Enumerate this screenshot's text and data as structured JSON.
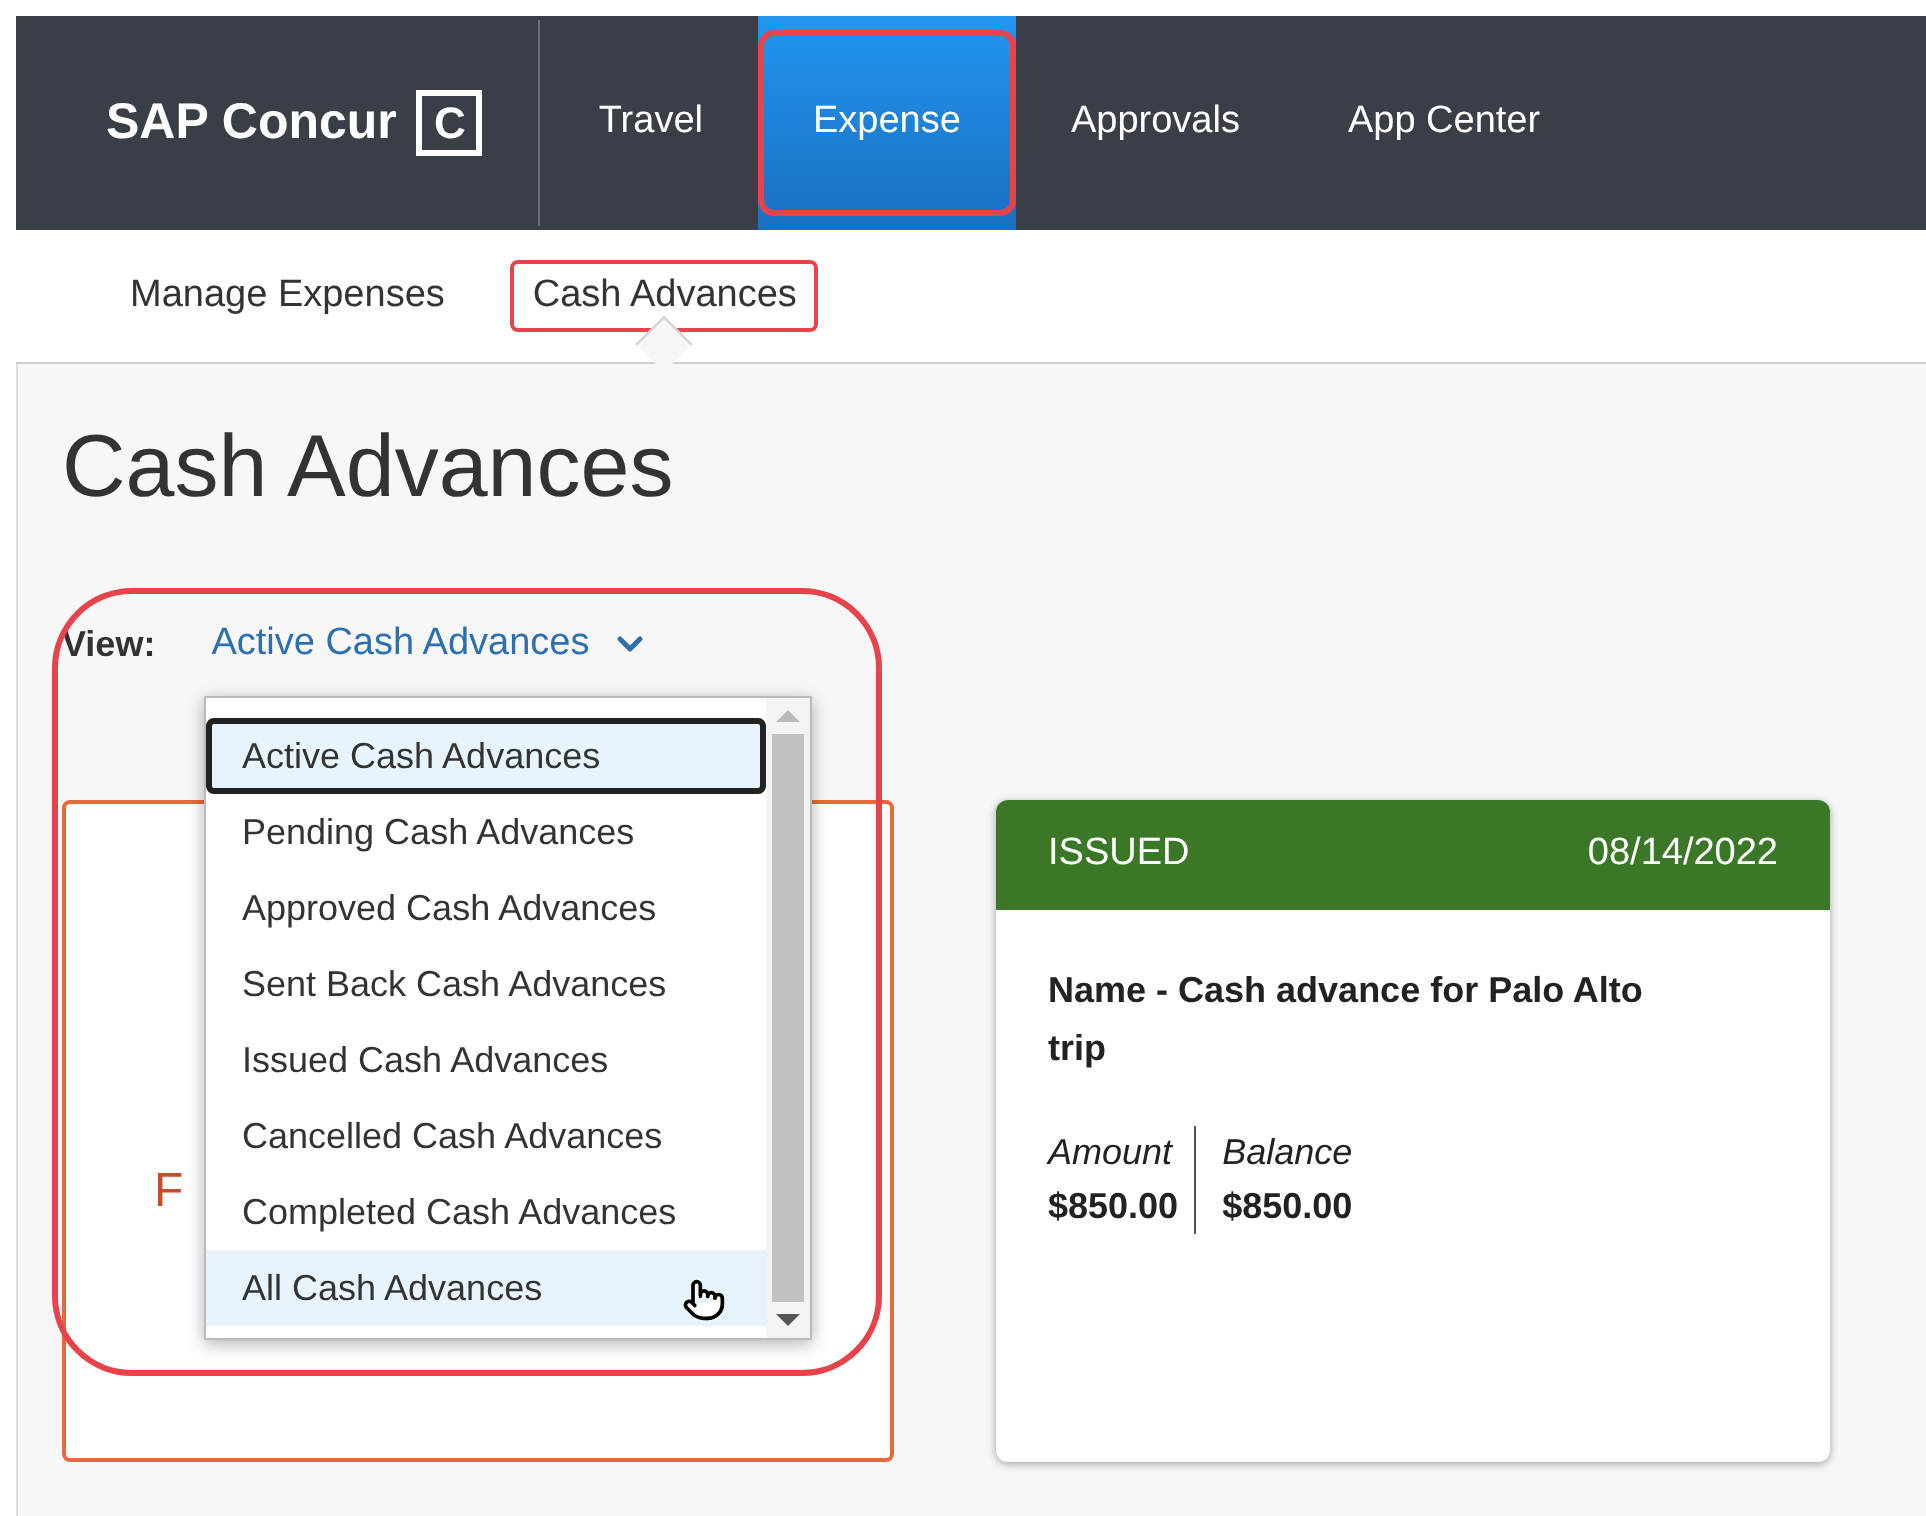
{
  "brand": {
    "name": "SAP Concur",
    "mark": "C"
  },
  "nav": [
    {
      "label": "Travel",
      "selected": false,
      "callout": false
    },
    {
      "label": "Expense",
      "selected": true,
      "callout": true
    },
    {
      "label": "Approvals",
      "selected": false,
      "callout": false
    },
    {
      "label": "App Center",
      "selected": false,
      "callout": false
    }
  ],
  "subnav": [
    {
      "label": "Manage Expenses",
      "selected": false,
      "callout": false
    },
    {
      "label": "Cash Advances",
      "selected": true,
      "callout": true
    }
  ],
  "page_title": "Cash Advances",
  "view": {
    "label": "View:",
    "value": "Active Cash Advances",
    "callout": true
  },
  "dropdown": {
    "options": [
      {
        "label": "Active Cash Advances",
        "selected": true,
        "hovered": false
      },
      {
        "label": "Pending Cash Advances",
        "selected": false,
        "hovered": false
      },
      {
        "label": "Approved Cash Advances",
        "selected": false,
        "hovered": false
      },
      {
        "label": "Sent Back Cash Advances",
        "selected": false,
        "hovered": false
      },
      {
        "label": "Issued Cash Advances",
        "selected": false,
        "hovered": false
      },
      {
        "label": "Cancelled Cash Advances",
        "selected": false,
        "hovered": false
      },
      {
        "label": "Completed Cash Advances",
        "selected": false,
        "hovered": false
      },
      {
        "label": "All Cash Advances",
        "selected": false,
        "hovered": true
      }
    ]
  },
  "cards": [
    {
      "kind": "fragment",
      "text": "F"
    },
    {
      "kind": "advance",
      "status": "ISSUED",
      "date": "08/14/2022",
      "name": "Name - Cash advance for Palo Alto trip",
      "amount_label": "Amount",
      "amount": "$850.00",
      "balance_label": "Balance",
      "balance": "$850.00"
    }
  ]
}
